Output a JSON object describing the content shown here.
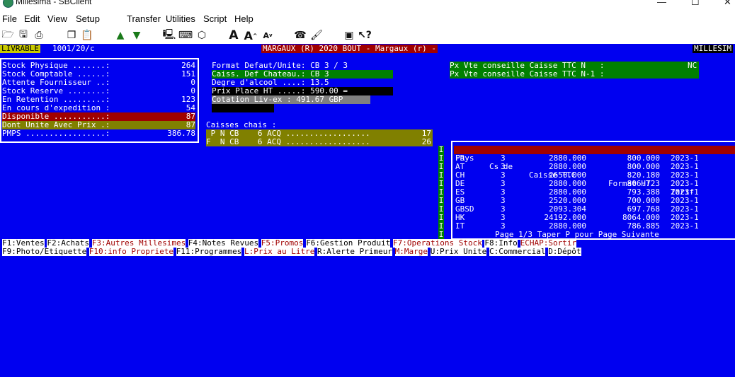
{
  "window": {
    "title": "Millesima - SBClient"
  },
  "menu": [
    "File",
    "Edit",
    "View",
    "Setup",
    "Transfer",
    "Utilities",
    "Script",
    "Help"
  ],
  "header": {
    "left_badge": "LIVRABLE",
    "code": "1001/20/c",
    "product": "MARGAUX (R) 2020 BOUT - Margaux (r) -",
    "right_badge": "MILLESIM"
  },
  "stock": [
    {
      "label": "Stock Physique .......:",
      "value": "264"
    },
    {
      "label": "Stock Comptable ......:",
      "value": "151"
    },
    {
      "label": "Attente Fournisseur ..:",
      "value": "0"
    },
    {
      "label": "Stock Reserve ........:",
      "value": "0"
    },
    {
      "label": "En Retention .........:",
      "value": "123"
    },
    {
      "label": "En cours d'expedition :",
      "value": "54"
    },
    {
      "label": "Disponible ...........:",
      "value": "87"
    },
    {
      "label": "Dont Unite Avec Prix .:",
      "value": "87"
    },
    {
      "label": "PMPS .................:",
      "value": "386.78"
    }
  ],
  "info": {
    "format": "Format Defaut/Unite: CB 3 / 3",
    "caiss": "Caiss. Def Chateau.: CB 3",
    "degre": "Degre d'alcool ....: 13.5",
    "prix": "Prix Place HT .....: 590.00 =",
    "cotation": "Cotation Liv-ex : 491.67 GBP"
  },
  "px": {
    "n": "Px Vte conseille Caisse TTC N   :",
    "n_value": "NC",
    "n1": "Px Vte conseille Caisse TTC N-1 :"
  },
  "caisses": {
    "title": "Caisses chais :",
    "rows": [
      {
        "text": " P N CB    6 ACQ ..................",
        "qty": "17"
      },
      {
        "text": "F  N CB    6 ACQ ..................",
        "qty": "26"
      }
    ]
  },
  "tarif": {
    "headers": [
      "Pays",
      "Cs de",
      "Caisse TTC",
      "Format HT",
      "Tarif"
    ],
    "rows": [
      {
        "pays": "FR",
        "cs": "3",
        "caisse": "2880.000",
        "format": "800.000",
        "tarif": "2023-1"
      },
      {
        "pays": "AT",
        "cs": "3",
        "caisse": "2880.000",
        "format": "800.000",
        "tarif": "2023-1"
      },
      {
        "pays": "CH",
        "cs": "3",
        "caisse": "2650.000",
        "format": "820.180",
        "tarif": "2023-1"
      },
      {
        "pays": "DE",
        "cs": "3",
        "caisse": "2880.000",
        "format": "806.723",
        "tarif": "2023-1"
      },
      {
        "pays": "ES",
        "cs": "3",
        "caisse": "2880.000",
        "format": "793.388",
        "tarif": "2023-1"
      },
      {
        "pays": "GB",
        "cs": "3",
        "caisse": "2520.000",
        "format": "700.000",
        "tarif": "2023-1"
      },
      {
        "pays": "GBSD",
        "cs": "3",
        "caisse": "2093.304",
        "format": "697.768",
        "tarif": "2023-1"
      },
      {
        "pays": "HK",
        "cs": "3",
        "caisse": "24192.000",
        "format": "8064.000",
        "tarif": "2023-1"
      },
      {
        "pays": "IT",
        "cs": "3",
        "caisse": "2880.000",
        "format": "786.885",
        "tarif": "2023-1"
      }
    ],
    "marker": "I",
    "page_info": "Page 1/3 Taper P pour Page Suivante"
  },
  "fkeys_row1": [
    {
      "label": "F1:Ventes",
      "style": "w"
    },
    {
      "label": "F2:Achats",
      "style": "w"
    },
    {
      "label": "F3:Autres Millesimes",
      "style": "r"
    },
    {
      "label": "F4:Notes Revues",
      "style": "w"
    },
    {
      "label": "F5:Promos",
      "style": "r"
    },
    {
      "label": "F6:Gestion Produit",
      "style": "w"
    },
    {
      "label": "F7:Operations Stock",
      "style": "r"
    },
    {
      "label": "F8:Info",
      "style": "w"
    },
    {
      "label": "ECHAP:Sortir",
      "style": "r"
    }
  ],
  "fkeys_row2": [
    {
      "label": "F9:Photo/Etiquette",
      "style": "w"
    },
    {
      "label": "F10:info Propriete",
      "style": "r"
    },
    {
      "label": "F11:Programmes",
      "style": "w"
    },
    {
      "label": "L:Prix au Litre",
      "style": "r"
    },
    {
      "label": "R:Alerte Primeur",
      "style": "w"
    },
    {
      "label": "M:Marge",
      "style": "r"
    },
    {
      "label": "U:Prix Unite",
      "style": "w"
    },
    {
      "label": "C:Commercial",
      "style": "w"
    },
    {
      "label": "D:Dépôt",
      "style": "w"
    }
  ],
  "colors": {
    "terminal_bg": "#0000f0",
    "green": "#008000",
    "olive": "#808000",
    "red": "#a00000",
    "dark_red": "#8b0000"
  }
}
